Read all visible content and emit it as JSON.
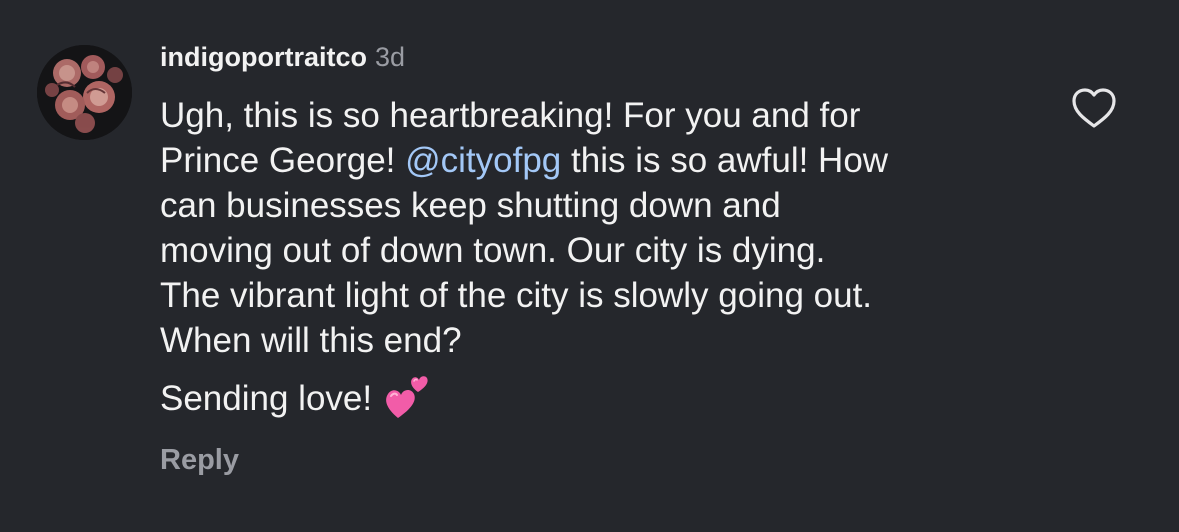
{
  "comment": {
    "username": "indigoportraitco",
    "timestamp": "3d",
    "text_lines": {
      "l1": "Ugh, this is so heartbreaking! For you and for",
      "l2_before": "Prince George! ",
      "l2_mention": "@cityofpg",
      "l2_after": " this is so awful! How",
      "l3": "can businesses keep shutting down and",
      "l4": "moving out of down town. Our city is dying.",
      "l5": "The vibrant light of the city is slowly going out.",
      "l6": "When will this end?"
    },
    "sign_off": "Sending love!",
    "sign_off_emoji": "two-hearts-icon",
    "reply_label": "Reply",
    "like_icon": "heart-outline-icon",
    "avatar_icon": "flowers-avatar"
  },
  "colors": {
    "background": "#25272c",
    "text": "#f2f2f2",
    "muted": "#9a9ca3",
    "mention": "#a3c8f7",
    "emoji_pink": "#f25ca8"
  }
}
